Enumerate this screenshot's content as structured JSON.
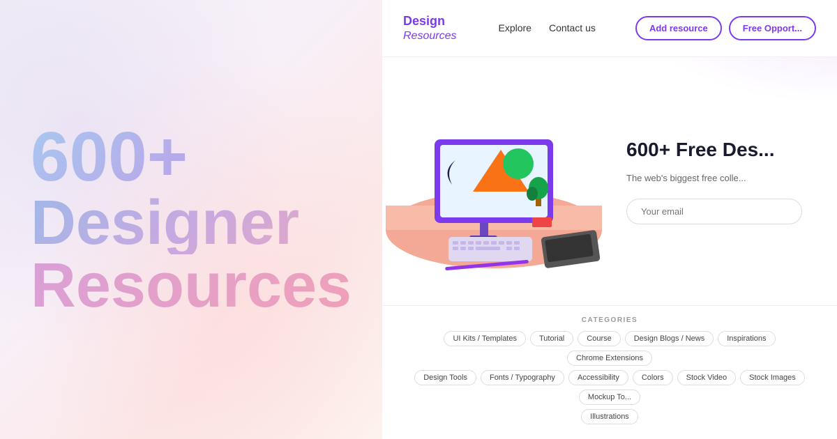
{
  "left": {
    "hero_number": "600+",
    "hero_word1": "Designer",
    "hero_word2": "Resources"
  },
  "navbar": {
    "logo_line1": "Design",
    "logo_line2": "Resources",
    "explore_label": "Explore",
    "contact_label": "Contact us",
    "add_resource_label": "Add resource",
    "free_opport_label": "Free Opport..."
  },
  "hero": {
    "title": "600+ Free Des...",
    "subtitle": "The web's biggest free colle...",
    "email_placeholder": "Your email"
  },
  "categories": {
    "section_label": "CATEGORIES",
    "row1": [
      "UI Kits / Templates",
      "Tutorial",
      "Course",
      "Design Blogs / News",
      "Inspirations",
      "Chrome Extensions"
    ],
    "row2": [
      "Design Tools",
      "Fonts / Typography",
      "Accessibility",
      "Colors",
      "Stock Video",
      "Stock Images",
      "Mockup To..."
    ],
    "row3": [
      "Illustrations"
    ]
  }
}
